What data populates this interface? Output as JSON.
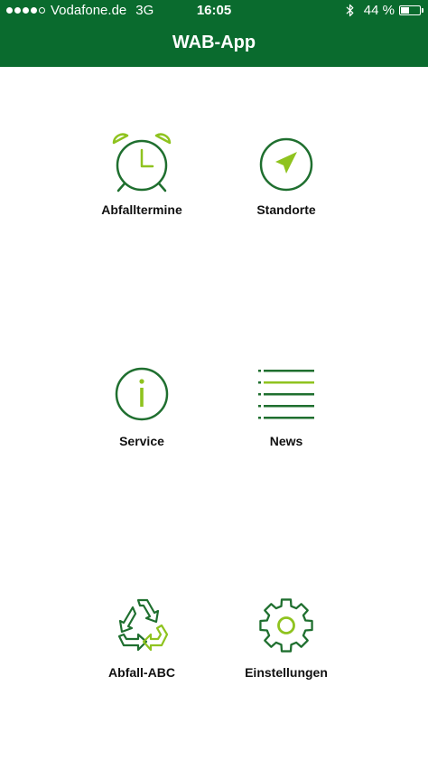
{
  "status_bar": {
    "signal_dots_filled": 4,
    "signal_dots_total": 5,
    "carrier": "Vodafone.de",
    "network": "3G",
    "time": "16:05",
    "bluetooth_icon": "bluetooth-icon",
    "battery_text": "44 %",
    "battery_level": 0.44
  },
  "nav": {
    "title": "WAB-App"
  },
  "colors": {
    "brand_green": "#0a6b2e",
    "accent_lime": "#8fc31f",
    "icon_green": "#1f6f2f"
  },
  "menu": [
    {
      "label": "Abfalltermine",
      "icon": "alarm-clock-icon"
    },
    {
      "label": "Standorte",
      "icon": "compass-icon"
    },
    {
      "label": "Service",
      "icon": "info-icon"
    },
    {
      "label": "News",
      "icon": "news-list-icon"
    },
    {
      "label": "Abfall-ABC",
      "icon": "recycle-icon"
    },
    {
      "label": "Einstellungen",
      "icon": "gear-icon"
    }
  ]
}
